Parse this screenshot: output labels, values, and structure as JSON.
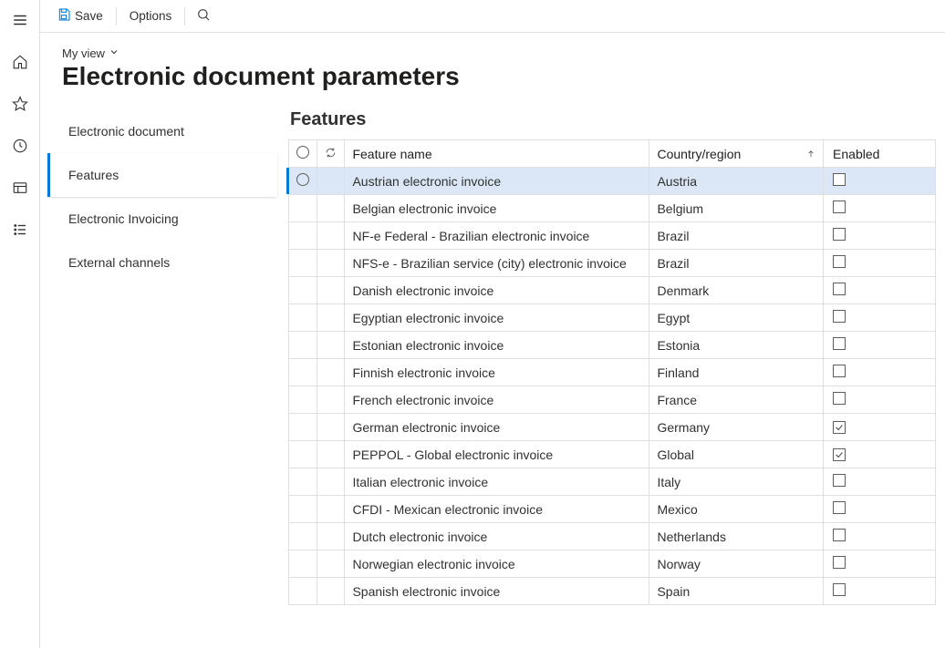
{
  "actionBar": {
    "save": "Save",
    "options": "Options"
  },
  "viewSelector": "My view",
  "pageTitle": "Electronic document parameters",
  "tabs": {
    "electronicDocument": "Electronic document",
    "features": "Features",
    "electronicInvoicing": "Electronic Invoicing",
    "externalChannels": "External channels"
  },
  "pane": {
    "title": "Features",
    "columns": {
      "featureName": "Feature name",
      "countryRegion": "Country/region",
      "enabled": "Enabled"
    },
    "rows": [
      {
        "name": "Austrian electronic invoice",
        "country": "Austria",
        "enabled": false,
        "selected": true
      },
      {
        "name": "Belgian electronic invoice",
        "country": "Belgium",
        "enabled": false,
        "selected": false
      },
      {
        "name": "NF-e  Federal - Brazilian electronic invoice",
        "country": "Brazil",
        "enabled": false,
        "selected": false
      },
      {
        "name": "NFS-e - Brazilian service (city) electronic invoice",
        "country": "Brazil",
        "enabled": false,
        "selected": false
      },
      {
        "name": "Danish electronic invoice",
        "country": "Denmark",
        "enabled": false,
        "selected": false
      },
      {
        "name": "Egyptian electronic invoice",
        "country": "Egypt",
        "enabled": false,
        "selected": false
      },
      {
        "name": "Estonian electronic invoice",
        "country": "Estonia",
        "enabled": false,
        "selected": false
      },
      {
        "name": "Finnish electronic invoice",
        "country": "Finland",
        "enabled": false,
        "selected": false
      },
      {
        "name": "French electronic invoice",
        "country": "France",
        "enabled": false,
        "selected": false
      },
      {
        "name": "German electronic invoice",
        "country": "Germany",
        "enabled": true,
        "selected": false
      },
      {
        "name": "PEPPOL - Global electronic invoice",
        "country": "Global",
        "enabled": true,
        "selected": false
      },
      {
        "name": "Italian electronic invoice",
        "country": "Italy",
        "enabled": false,
        "selected": false
      },
      {
        "name": "CFDI - Mexican electronic invoice",
        "country": "Mexico",
        "enabled": false,
        "selected": false
      },
      {
        "name": "Dutch electronic invoice",
        "country": "Netherlands",
        "enabled": false,
        "selected": false
      },
      {
        "name": "Norwegian electronic invoice",
        "country": "Norway",
        "enabled": false,
        "selected": false
      },
      {
        "name": "Spanish electronic invoice",
        "country": "Spain",
        "enabled": false,
        "selected": false
      }
    ]
  }
}
